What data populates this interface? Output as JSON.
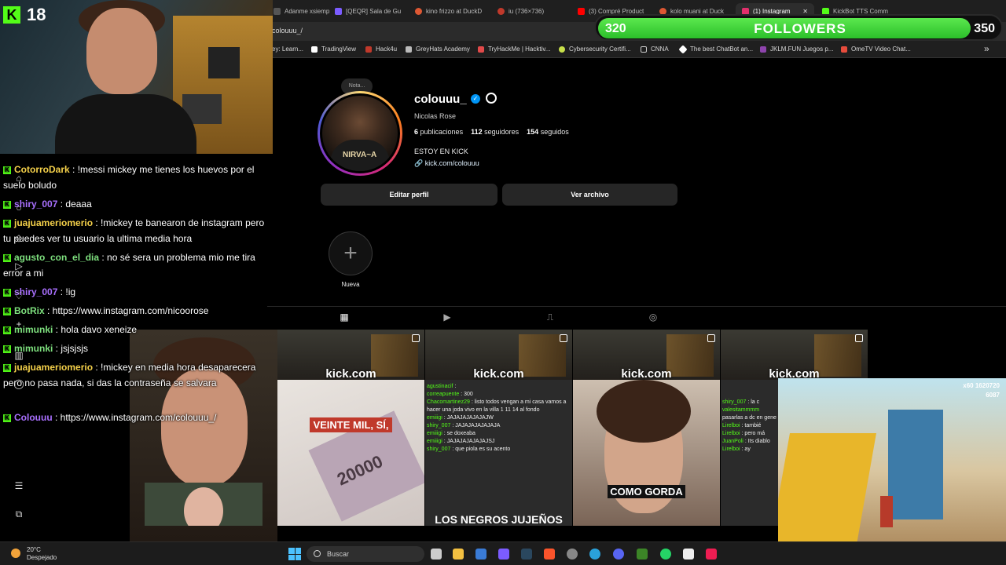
{
  "browser": {
    "tabs": [
      {
        "label": "Adanme xsiemp"
      },
      {
        "label": "[QEQR] Sala de Gu"
      },
      {
        "label": "kino frizzo at DuckD"
      },
      {
        "label": "iu (736×736)"
      },
      {
        "label": "(3) Compré Product"
      },
      {
        "label": "kolo muani at Duck"
      },
      {
        "label": "(1) Instagram"
      },
      {
        "label": "KickBot TTS Comm"
      }
    ],
    "url": "colouuu_/",
    "bookmarks": [
      {
        "label": "ey: Learn..."
      },
      {
        "label": "TradingView"
      },
      {
        "label": "Hack4u"
      },
      {
        "label": "GreyHats Academy"
      },
      {
        "label": "TryHackMe | Hacktiv..."
      },
      {
        "label": "Cybersecurity Certifi..."
      },
      {
        "label": "CNNA"
      },
      {
        "label": "The best ChatBot an..."
      },
      {
        "label": "JKLM.FUN Juegos p..."
      },
      {
        "label": "OmeTV Video Chat..."
      }
    ],
    "bookmarks_overflow": "»"
  },
  "overlay": {
    "viewer_count": "18",
    "followers_goal": {
      "current_label": "320",
      "title": "FOLLOWERS",
      "target_label": "350",
      "progress": 0.93
    }
  },
  "profile": {
    "note": "Nota...",
    "username": "colouuu_",
    "full_name": "Nicolas Rose",
    "posts": "6",
    "posts_label": "publicaciones",
    "followers": "112",
    "followers_label": "seguidores",
    "following": "154",
    "following_label": "seguidos",
    "bio": "ESTOY EN KICK",
    "link": "kick.com/colouuu",
    "avatar_shirt": "NIRVA~A",
    "edit_button": "Editar perfil",
    "archive_button": "Ver archivo",
    "new_highlight": "Nueva",
    "new_highlight_icon": "+"
  },
  "chat": {
    "messages": [
      {
        "user": "CotorroDark",
        "text": " : !messi mickey me tienes los huevos por el suelo boludo",
        "color": "#f5d14a"
      },
      {
        "user": "shiry_007",
        "text": " : deaaa",
        "color": "#a970ff"
      },
      {
        "user": "juajuameriomerio",
        "text": " : !mickey te banearon de instagram pero tu puedes ver tu usuario la ultima media hora",
        "color": "#f5d14a"
      },
      {
        "user": "agusto_con_el_dia",
        "text": " : no sé sera un problema mio me tira error a mi",
        "color": "#7ee07e"
      },
      {
        "user": "shiry_007",
        "text": " : !ig",
        "color": "#a970ff"
      },
      {
        "user": "BotRix",
        "text": " : https://www.instagram.com/nicoorose",
        "color": "#7ee07e"
      },
      {
        "user": "mimunki",
        "text": " : hola davo xeneize",
        "color": "#7ee07e"
      },
      {
        "user": "mimunki",
        "text": " : jsjsjsjs",
        "color": "#7ee07e"
      },
      {
        "user": "juajuameriomerio",
        "text": " : !mickey en media hora desaparecera pero no pasa nada, si das la contraseña se salvara",
        "color": "#f5d14a"
      },
      {
        "user": "Colouuu",
        "text": " : https://www.instagram.com/colouuu_/",
        "color": "#a970ff"
      }
    ]
  },
  "posts": [
    {
      "watermark": "kick.com\n/Colouuu",
      "caption": "VEINTE MIL, SÍ,",
      "caption2": "",
      "note": "20000"
    },
    {
      "watermark": "kick.com\n/Colouuu",
      "caption": "LOS NEGROS JUJEÑOS",
      "caption2": ""
    },
    {
      "watermark": "kick.com\n/Colouuu",
      "caption": "COMO GORDA",
      "caption2": ""
    },
    {
      "watermark": "kick.com\n/Co",
      "caption": "",
      "caption2": ""
    }
  ],
  "post_chat": [
    {
      "user": "agustinacif",
      "text": ":"
    },
    {
      "user": "correapuente",
      "text": ": 300"
    },
    {
      "user": "Chacomartinez29",
      "text": ": listo todos vengan a mi casa vamos a hacer una joda vivo en la villa 1 11 14 al fondo"
    },
    {
      "user": "emiiigi",
      "text": ": JAJAJAJAJAJAJW"
    },
    {
      "user": "shiry_007",
      "text": ": JAJAJAJAJAJAJA"
    },
    {
      "user": "emiiigi",
      "text": ": se doxeaba"
    },
    {
      "user": "emiiigi",
      "text": ": JAJAJAJAJAJAJSJ"
    },
    {
      "user": "shiry_007",
      "text": ": que piola es su acento"
    }
  ],
  "post4_chat": [
    {
      "user": "shiry_007",
      "text": ": la c"
    },
    {
      "user": "valesitammmm",
      "text": "pasarlas a dc en gene"
    },
    {
      "user": "Lirelboi",
      "text": ": tambié"
    },
    {
      "user": "Lirelboi",
      "text": ": pero má"
    },
    {
      "user": "JuanPoli",
      "text": ": Its diablo"
    },
    {
      "user": "Lirelboi",
      "text": ": ay"
    }
  ],
  "game": {
    "score": "1620720",
    "coins": "6087",
    "multiplier": "x60"
  },
  "taskbar": {
    "temp": "20°C",
    "condition": "Despejado",
    "search_placeholder": "Buscar"
  },
  "colors": {
    "kick_green": "#53fc18",
    "ig_bg": "#000000",
    "verified": "#0095f6"
  }
}
